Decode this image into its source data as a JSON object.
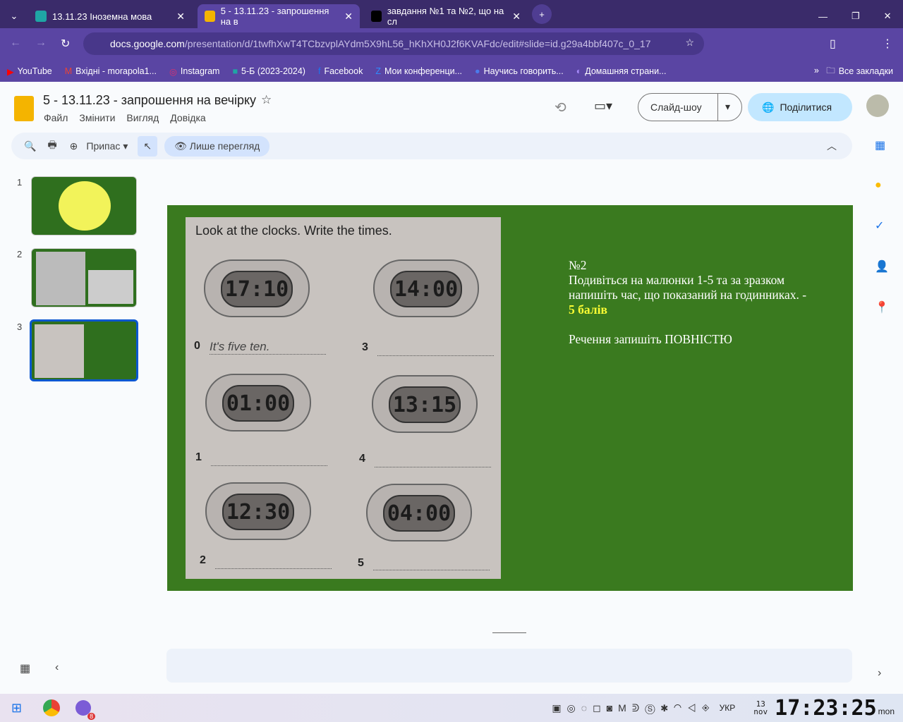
{
  "browser": {
    "tabs": [
      {
        "title": "13.11.23 Іноземна мова",
        "color": "#1fa5a5"
      },
      {
        "title": "5 - 13.11.23 - запрошення на в",
        "color": "#f4b400",
        "active": true
      },
      {
        "title": "завдання №1 та №2, що на сл",
        "color": "#000000"
      }
    ],
    "url_host": "docs.google.com",
    "url_path": "/presentation/d/1twfhXwT4TCbzvplAYdm5X9hL56_hKhXH0J2f6KVAFdc/edit#slide=id.g29a4bbf407c_0_17",
    "bookmarks": [
      "YouTube",
      "Вхідні - morapola1...",
      "Instagram",
      "5-Б (2023-2024)",
      "Facebook",
      "Мои конференци...",
      "Научись говорить...",
      "Домашняя страни..."
    ],
    "all_bookmarks": "Все закладки"
  },
  "doc": {
    "title": "5 - 13.11.23 - запрошення на вечірку",
    "menu": [
      "Файл",
      "Змінити",
      "Вигляд",
      "Довідка"
    ],
    "slideshow": "Слайд-шоу",
    "share": "Поділитися",
    "zoom": "Припас",
    "view_only": "Лише перегляд"
  },
  "thumbs": [
    "1",
    "2",
    "3"
  ],
  "slide": {
    "heading": "Look at the clocks. Write the times.",
    "clocks": [
      {
        "n": "0",
        "time": "17:10",
        "answer": "It's five ten."
      },
      {
        "n": "3",
        "time": "14:00"
      },
      {
        "n": "1",
        "time": "01:00"
      },
      {
        "n": "4",
        "time": "13:15"
      },
      {
        "n": "2",
        "time": "12:30"
      },
      {
        "n": "5",
        "time": "04:00"
      }
    ],
    "task_no": "№2",
    "task": "Подивіться на малюнки 1-5  та за зразком напишіть час, що показаний на годинниках.  - ",
    "points": "5 балів",
    "note": "Речення запишіть ПОВНІСТЮ"
  },
  "taskbar": {
    "lang": "УКР",
    "day": "13",
    "month": "nov",
    "time": "17:23:25",
    "weekday": "mon",
    "badge": "8"
  }
}
